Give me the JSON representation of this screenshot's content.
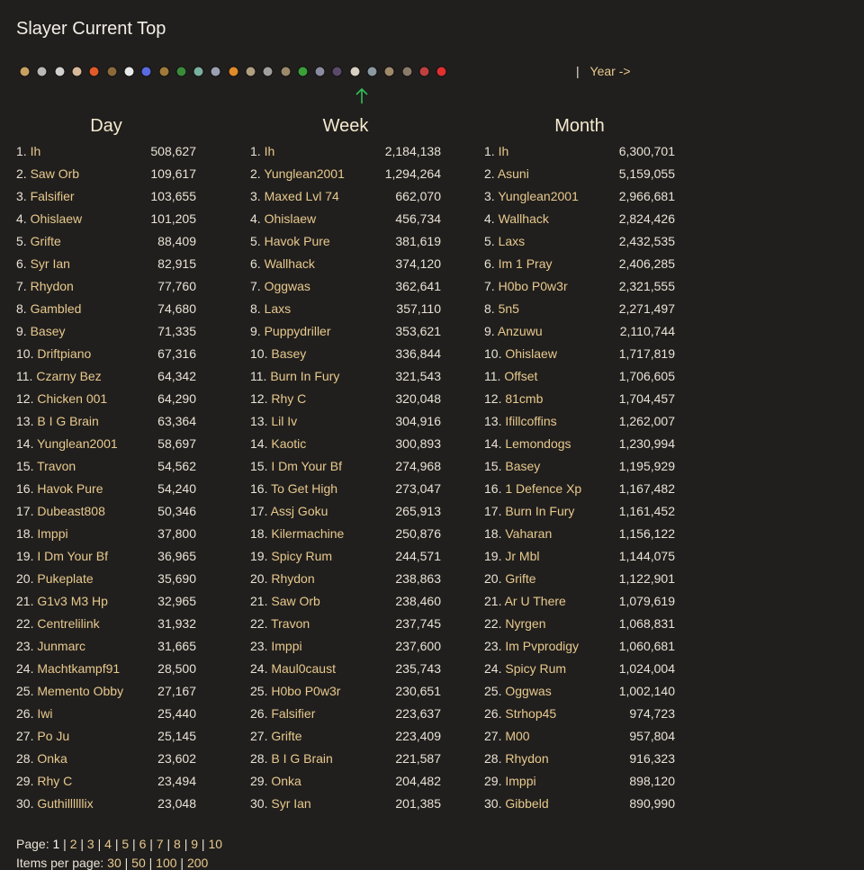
{
  "page_title": "Slayer Current Top",
  "year_nav": {
    "separator": "|",
    "label": "Year ->"
  },
  "skills": [
    {
      "icon": "overall-icon",
      "color": "#c8a060"
    },
    {
      "icon": "attack-icon",
      "color": "#b8b8b8"
    },
    {
      "icon": "defence-icon",
      "color": "#d0d0d0"
    },
    {
      "icon": "strength-icon",
      "color": "#d8b89a"
    },
    {
      "icon": "hitpoints-icon",
      "color": "#e05a2a"
    },
    {
      "icon": "ranged-icon",
      "color": "#8a6a3a"
    },
    {
      "icon": "prayer-icon",
      "color": "#e8e8e8"
    },
    {
      "icon": "magic-icon",
      "color": "#5a6ae0"
    },
    {
      "icon": "cooking-icon",
      "color": "#a07a3a"
    },
    {
      "icon": "woodcutting-icon",
      "color": "#3a8a3a"
    },
    {
      "icon": "fletching-icon",
      "color": "#7ab0a0"
    },
    {
      "icon": "fishing-icon",
      "color": "#9aa0b0"
    },
    {
      "icon": "firemaking-icon",
      "color": "#e08a2a"
    },
    {
      "icon": "crafting-icon",
      "color": "#b0a080"
    },
    {
      "icon": "smithing-icon",
      "color": "#a0a0a0"
    },
    {
      "icon": "mining-icon",
      "color": "#9a8a6a"
    },
    {
      "icon": "herblore-icon",
      "color": "#3aa03a"
    },
    {
      "icon": "agility-icon",
      "color": "#8a8aa0"
    },
    {
      "icon": "thieving-icon",
      "color": "#5a4a6a"
    },
    {
      "icon": "slayer-icon",
      "color": "#d8d0c0"
    },
    {
      "icon": "farming-icon",
      "color": "#8a9aa0"
    },
    {
      "icon": "runecraft-icon",
      "color": "#a08a6a"
    },
    {
      "icon": "hunter-icon",
      "color": "#8a7a6a"
    },
    {
      "icon": "construction-icon",
      "color": "#c04040"
    },
    {
      "icon": "ehp-icon",
      "color": "#e03030"
    }
  ],
  "selected_skill_index": 19,
  "columns": [
    {
      "title": "Day",
      "rows": [
        {
          "rank": "1.",
          "name": "Ih",
          "value": "508,627"
        },
        {
          "rank": "2.",
          "name": "Saw Orb",
          "value": "109,617"
        },
        {
          "rank": "3.",
          "name": "Falsifier",
          "value": "103,655"
        },
        {
          "rank": "4.",
          "name": "Ohislaew",
          "value": "101,205"
        },
        {
          "rank": "5.",
          "name": "Grifte",
          "value": "88,409"
        },
        {
          "rank": "6.",
          "name": "Syr Ian",
          "value": "82,915"
        },
        {
          "rank": "7.",
          "name": "Rhydon",
          "value": "77,760"
        },
        {
          "rank": "8.",
          "name": "Gambled",
          "value": "74,680"
        },
        {
          "rank": "9.",
          "name": "Basey",
          "value": "71,335"
        },
        {
          "rank": "10.",
          "name": "Driftpiano",
          "value": "67,316"
        },
        {
          "rank": "11.",
          "name": "Czarny Bez",
          "value": "64,342"
        },
        {
          "rank": "12.",
          "name": "Chicken 001",
          "value": "64,290"
        },
        {
          "rank": "13.",
          "name": "B I G Brain",
          "value": "63,364"
        },
        {
          "rank": "14.",
          "name": "Yunglean2001",
          "value": "58,697"
        },
        {
          "rank": "15.",
          "name": "Travon",
          "value": "54,562"
        },
        {
          "rank": "16.",
          "name": "Havok Pure",
          "value": "54,240"
        },
        {
          "rank": "17.",
          "name": "Dubeast808",
          "value": "50,346"
        },
        {
          "rank": "18.",
          "name": "Imppi",
          "value": "37,800"
        },
        {
          "rank": "19.",
          "name": "I Dm Your Bf",
          "value": "36,965"
        },
        {
          "rank": "20.",
          "name": "Pukeplate",
          "value": "35,690"
        },
        {
          "rank": "21.",
          "name": "G1v3 M3 Hp",
          "value": "32,965"
        },
        {
          "rank": "22.",
          "name": "Centrelilink",
          "value": "31,932"
        },
        {
          "rank": "23.",
          "name": "Junmarc",
          "value": "31,665"
        },
        {
          "rank": "24.",
          "name": "Machtkampf91",
          "value": "28,500"
        },
        {
          "rank": "25.",
          "name": "Memento Obby",
          "value": "27,167"
        },
        {
          "rank": "26.",
          "name": "Iwi",
          "value": "25,440"
        },
        {
          "rank": "27.",
          "name": "Po Ju",
          "value": "25,145"
        },
        {
          "rank": "28.",
          "name": "Onka",
          "value": "23,602"
        },
        {
          "rank": "29.",
          "name": "Rhy C",
          "value": "23,494"
        },
        {
          "rank": "30.",
          "name": "Guthillllllix",
          "value": "23,048"
        }
      ]
    },
    {
      "title": "Week",
      "rows": [
        {
          "rank": "1.",
          "name": "Ih",
          "value": "2,184,138"
        },
        {
          "rank": "2.",
          "name": "Yunglean2001",
          "value": "1,294,264"
        },
        {
          "rank": "3.",
          "name": "Maxed Lvl 74",
          "value": "662,070"
        },
        {
          "rank": "4.",
          "name": "Ohislaew",
          "value": "456,734"
        },
        {
          "rank": "5.",
          "name": "Havok Pure",
          "value": "381,619"
        },
        {
          "rank": "6.",
          "name": "Wallhack",
          "value": "374,120"
        },
        {
          "rank": "7.",
          "name": "Oggwas",
          "value": "362,641"
        },
        {
          "rank": "8.",
          "name": "Laxs",
          "value": "357,110"
        },
        {
          "rank": "9.",
          "name": "Puppydriller",
          "value": "353,621"
        },
        {
          "rank": "10.",
          "name": "Basey",
          "value": "336,844"
        },
        {
          "rank": "11.",
          "name": "Burn In Fury",
          "value": "321,543"
        },
        {
          "rank": "12.",
          "name": "Rhy C",
          "value": "320,048"
        },
        {
          "rank": "13.",
          "name": "Lil Iv",
          "value": "304,916"
        },
        {
          "rank": "14.",
          "name": "Kaotic",
          "value": "300,893"
        },
        {
          "rank": "15.",
          "name": "I Dm Your Bf",
          "value": "274,968"
        },
        {
          "rank": "16.",
          "name": "To Get High",
          "value": "273,047"
        },
        {
          "rank": "17.",
          "name": "Assj Goku",
          "value": "265,913"
        },
        {
          "rank": "18.",
          "name": "Kilermachine",
          "value": "250,876"
        },
        {
          "rank": "19.",
          "name": "Spicy Rum",
          "value": "244,571"
        },
        {
          "rank": "20.",
          "name": "Rhydon",
          "value": "238,863"
        },
        {
          "rank": "21.",
          "name": "Saw Orb",
          "value": "238,460"
        },
        {
          "rank": "22.",
          "name": "Travon",
          "value": "237,745"
        },
        {
          "rank": "23.",
          "name": "Imppi",
          "value": "237,600"
        },
        {
          "rank": "24.",
          "name": "Maul0caust",
          "value": "235,743"
        },
        {
          "rank": "25.",
          "name": "H0bo P0w3r",
          "value": "230,651"
        },
        {
          "rank": "26.",
          "name": "Falsifier",
          "value": "223,637"
        },
        {
          "rank": "27.",
          "name": "Grifte",
          "value": "223,409"
        },
        {
          "rank": "28.",
          "name": "B I G Brain",
          "value": "221,587"
        },
        {
          "rank": "29.",
          "name": "Onka",
          "value": "204,482"
        },
        {
          "rank": "30.",
          "name": "Syr Ian",
          "value": "201,385"
        }
      ]
    },
    {
      "title": "Month",
      "rows": [
        {
          "rank": "1.",
          "name": "Ih",
          "value": "6,300,701"
        },
        {
          "rank": "2.",
          "name": "Asuni",
          "value": "5,159,055"
        },
        {
          "rank": "3.",
          "name": "Yunglean2001",
          "value": "2,966,681"
        },
        {
          "rank": "4.",
          "name": "Wallhack",
          "value": "2,824,426"
        },
        {
          "rank": "5.",
          "name": "Laxs",
          "value": "2,432,535"
        },
        {
          "rank": "6.",
          "name": "Im 1 Pray",
          "value": "2,406,285"
        },
        {
          "rank": "7.",
          "name": "H0bo P0w3r",
          "value": "2,321,555"
        },
        {
          "rank": "8.",
          "name": "5n5",
          "value": "2,271,497"
        },
        {
          "rank": "9.",
          "name": "Anzuwu",
          "value": "2,110,744"
        },
        {
          "rank": "10.",
          "name": "Ohislaew",
          "value": "1,717,819"
        },
        {
          "rank": "11.",
          "name": "Offset",
          "value": "1,706,605"
        },
        {
          "rank": "12.",
          "name": "81cmb",
          "value": "1,704,457"
        },
        {
          "rank": "13.",
          "name": "Ifillcoffins",
          "value": "1,262,007"
        },
        {
          "rank": "14.",
          "name": "Lemondogs",
          "value": "1,230,994"
        },
        {
          "rank": "15.",
          "name": "Basey",
          "value": "1,195,929"
        },
        {
          "rank": "16.",
          "name": "1 Defence Xp",
          "value": "1,167,482"
        },
        {
          "rank": "17.",
          "name": "Burn In Fury",
          "value": "1,161,452"
        },
        {
          "rank": "18.",
          "name": "Vaharan",
          "value": "1,156,122"
        },
        {
          "rank": "19.",
          "name": "Jr Mbl",
          "value": "1,144,075"
        },
        {
          "rank": "20.",
          "name": "Grifte",
          "value": "1,122,901"
        },
        {
          "rank": "21.",
          "name": "Ar U There",
          "value": "1,079,619"
        },
        {
          "rank": "22.",
          "name": "Nyrgen",
          "value": "1,068,831"
        },
        {
          "rank": "23.",
          "name": "Im Pvprodigy",
          "value": "1,060,681"
        },
        {
          "rank": "24.",
          "name": "Spicy Rum",
          "value": "1,024,004"
        },
        {
          "rank": "25.",
          "name": "Oggwas",
          "value": "1,002,140"
        },
        {
          "rank": "26.",
          "name": "Strhop45",
          "value": "974,723"
        },
        {
          "rank": "27.",
          "name": "M00",
          "value": "957,804"
        },
        {
          "rank": "28.",
          "name": "Rhydon",
          "value": "916,323"
        },
        {
          "rank": "29.",
          "name": "Imppi",
          "value": "898,120"
        },
        {
          "rank": "30.",
          "name": "Gibbeld",
          "value": "890,990"
        }
      ]
    }
  ],
  "pagination": {
    "label": "Page:",
    "current": "1",
    "pages": [
      "2",
      "3",
      "4",
      "5",
      "6",
      "7",
      "8",
      "9",
      "10"
    ],
    "separator": "|"
  },
  "items_per_page": {
    "label": "Items per page:",
    "options": [
      "30",
      "50",
      "100",
      "200"
    ],
    "separator": "|"
  },
  "colors": {
    "background": "#211f1d",
    "link": "#e7c98e",
    "text": "#e8e2d6",
    "arrow": "#2fbf5a"
  }
}
